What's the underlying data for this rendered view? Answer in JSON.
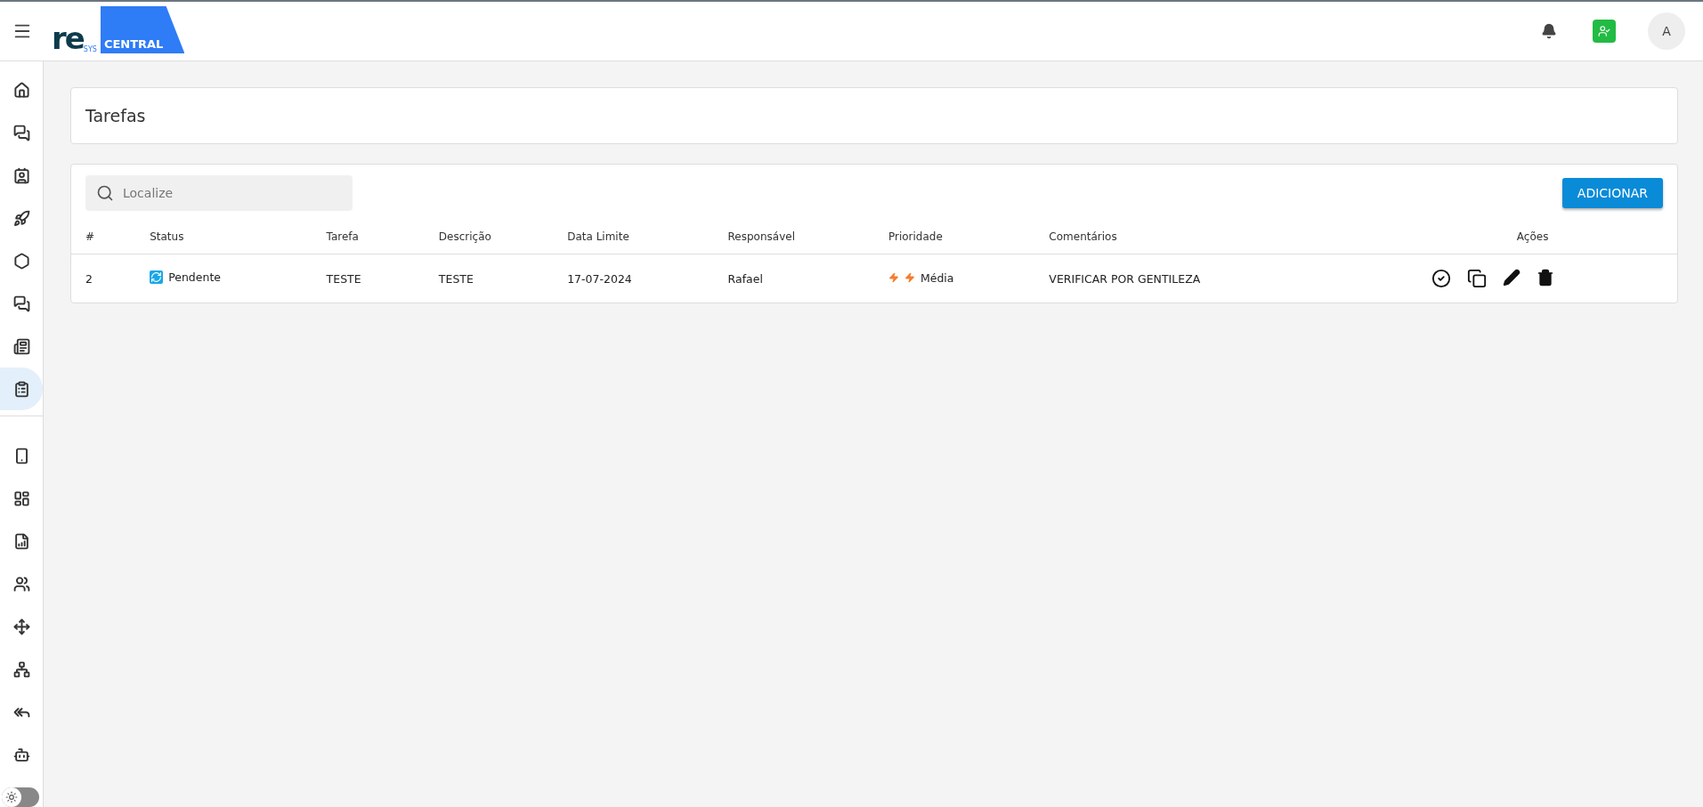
{
  "header": {
    "logo": {
      "mark": "re",
      "sub": "SYS",
      "tag": "CENTRAL"
    },
    "avatar": "A"
  },
  "sidebar": {
    "items": [
      {
        "selected": false
      },
      {
        "selected": false
      },
      {
        "selected": false
      },
      {
        "selected": false
      },
      {
        "selected": false
      },
      {
        "selected": false
      },
      {
        "selected": false
      },
      {
        "selected": true
      }
    ],
    "tools": [
      {
        "selected": false
      },
      {
        "selected": false
      },
      {
        "selected": false
      },
      {
        "selected": false
      },
      {
        "selected": false
      },
      {
        "selected": false
      },
      {
        "selected": false
      },
      {
        "selected": false
      }
    ],
    "theme_toggle": {
      "on": false
    }
  },
  "page": {
    "title": "Tarefas"
  },
  "search": {
    "placeholder": "Localize"
  },
  "add_button": "ADICIONAR",
  "table": {
    "columns": [
      "#",
      "Status",
      "Tarefa",
      "Descrição",
      "Data Limite",
      "Responsável",
      "Prioridade",
      "Comentários",
      "Ações"
    ],
    "rows": [
      {
        "id": "2",
        "status": "Pendente",
        "task": "TESTE",
        "description": "TESTE",
        "due": "17-07-2024",
        "owner": "Rafael",
        "priority": "Média",
        "comment": "VERIFICAR POR GENTILEZA"
      }
    ]
  }
}
